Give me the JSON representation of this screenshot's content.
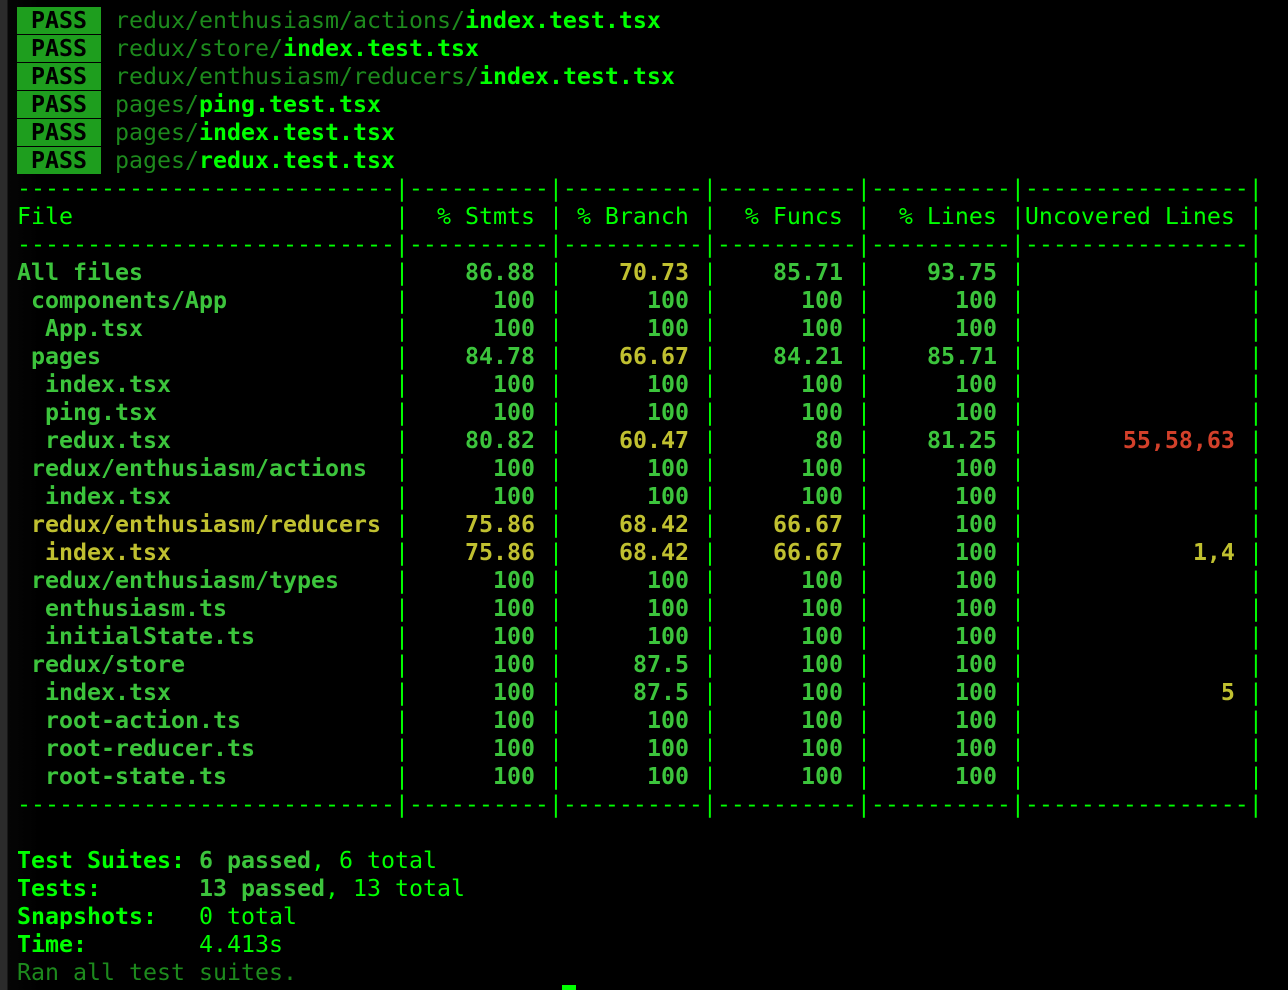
{
  "colors": {
    "high": "#3cc43c",
    "medium": "#c0c030",
    "low": "#d3402a",
    "accent": "#00ff00",
    "pass_badge": "#1e9e1e"
  },
  "test_results": [
    {
      "status": "PASS",
      "dir": "redux/enthusiasm/actions/",
      "file": "index.test.tsx"
    },
    {
      "status": "PASS",
      "dir": "redux/store/",
      "file": "index.test.tsx"
    },
    {
      "status": "PASS",
      "dir": "redux/enthusiasm/reducers/",
      "file": "index.test.tsx"
    },
    {
      "status": "PASS",
      "dir": "pages/",
      "file": "ping.test.tsx"
    },
    {
      "status": "PASS",
      "dir": "pages/",
      "file": "index.test.tsx"
    },
    {
      "status": "PASS",
      "dir": "pages/",
      "file": "redux.test.tsx"
    }
  ],
  "coverage": {
    "headers": [
      "File",
      "% Stmts",
      "% Branch",
      "% Funcs",
      "% Lines",
      "Uncovered Lines"
    ],
    "rows": [
      {
        "indent": 0,
        "file": "All files",
        "stmts": "86.88",
        "branch": "70.73",
        "funcs": "85.71",
        "lines": "93.75",
        "uncovered": "",
        "levels": [
          "high",
          "high",
          "medium",
          "high",
          "high",
          ""
        ]
      },
      {
        "indent": 1,
        "file": "components/App",
        "stmts": "100",
        "branch": "100",
        "funcs": "100",
        "lines": "100",
        "uncovered": "",
        "levels": [
          "high",
          "high",
          "high",
          "high",
          "high",
          ""
        ]
      },
      {
        "indent": 2,
        "file": "App.tsx",
        "stmts": "100",
        "branch": "100",
        "funcs": "100",
        "lines": "100",
        "uncovered": "",
        "levels": [
          "high",
          "high",
          "high",
          "high",
          "high",
          ""
        ]
      },
      {
        "indent": 1,
        "file": "pages",
        "stmts": "84.78",
        "branch": "66.67",
        "funcs": "84.21",
        "lines": "85.71",
        "uncovered": "",
        "levels": [
          "high",
          "high",
          "medium",
          "high",
          "high",
          ""
        ]
      },
      {
        "indent": 2,
        "file": "index.tsx",
        "stmts": "100",
        "branch": "100",
        "funcs": "100",
        "lines": "100",
        "uncovered": "",
        "levels": [
          "high",
          "high",
          "high",
          "high",
          "high",
          ""
        ]
      },
      {
        "indent": 2,
        "file": "ping.tsx",
        "stmts": "100",
        "branch": "100",
        "funcs": "100",
        "lines": "100",
        "uncovered": "",
        "levels": [
          "high",
          "high",
          "high",
          "high",
          "high",
          ""
        ]
      },
      {
        "indent": 2,
        "file": "redux.tsx",
        "stmts": "80.82",
        "branch": "60.47",
        "funcs": "80",
        "lines": "81.25",
        "uncovered": "55,58,63",
        "levels": [
          "high",
          "high",
          "medium",
          "high",
          "high",
          "low"
        ]
      },
      {
        "indent": 1,
        "file": "redux/enthusiasm/actions",
        "stmts": "100",
        "branch": "100",
        "funcs": "100",
        "lines": "100",
        "uncovered": "",
        "levels": [
          "high",
          "high",
          "high",
          "high",
          "high",
          ""
        ]
      },
      {
        "indent": 2,
        "file": "index.tsx",
        "stmts": "100",
        "branch": "100",
        "funcs": "100",
        "lines": "100",
        "uncovered": "",
        "levels": [
          "high",
          "high",
          "high",
          "high",
          "high",
          ""
        ]
      },
      {
        "indent": 1,
        "file": "redux/enthusiasm/reducers",
        "stmts": "75.86",
        "branch": "68.42",
        "funcs": "66.67",
        "lines": "100",
        "uncovered": "",
        "levels": [
          "medium",
          "medium",
          "medium",
          "medium",
          "high",
          ""
        ]
      },
      {
        "indent": 2,
        "file": "index.tsx",
        "stmts": "75.86",
        "branch": "68.42",
        "funcs": "66.67",
        "lines": "100",
        "uncovered": "1,4",
        "levels": [
          "medium",
          "medium",
          "medium",
          "medium",
          "high",
          "medium"
        ]
      },
      {
        "indent": 1,
        "file": "redux/enthusiasm/types",
        "stmts": "100",
        "branch": "100",
        "funcs": "100",
        "lines": "100",
        "uncovered": "",
        "levels": [
          "high",
          "high",
          "high",
          "high",
          "high",
          ""
        ]
      },
      {
        "indent": 2,
        "file": "enthusiasm.ts",
        "stmts": "100",
        "branch": "100",
        "funcs": "100",
        "lines": "100",
        "uncovered": "",
        "levels": [
          "high",
          "high",
          "high",
          "high",
          "high",
          ""
        ]
      },
      {
        "indent": 2,
        "file": "initialState.ts",
        "stmts": "100",
        "branch": "100",
        "funcs": "100",
        "lines": "100",
        "uncovered": "",
        "levels": [
          "high",
          "high",
          "high",
          "high",
          "high",
          ""
        ]
      },
      {
        "indent": 1,
        "file": "redux/store",
        "stmts": "100",
        "branch": "87.5",
        "funcs": "100",
        "lines": "100",
        "uncovered": "",
        "levels": [
          "high",
          "high",
          "high",
          "high",
          "high",
          ""
        ]
      },
      {
        "indent": 2,
        "file": "index.tsx",
        "stmts": "100",
        "branch": "87.5",
        "funcs": "100",
        "lines": "100",
        "uncovered": "5",
        "levels": [
          "high",
          "high",
          "high",
          "high",
          "high",
          "medium"
        ]
      },
      {
        "indent": 2,
        "file": "root-action.ts",
        "stmts": "100",
        "branch": "100",
        "funcs": "100",
        "lines": "100",
        "uncovered": "",
        "levels": [
          "high",
          "high",
          "high",
          "high",
          "high",
          ""
        ]
      },
      {
        "indent": 2,
        "file": "root-reducer.ts",
        "stmts": "100",
        "branch": "100",
        "funcs": "100",
        "lines": "100",
        "uncovered": "",
        "levels": [
          "high",
          "high",
          "high",
          "high",
          "high",
          ""
        ]
      },
      {
        "indent": 2,
        "file": "root-state.ts",
        "stmts": "100",
        "branch": "100",
        "funcs": "100",
        "lines": "100",
        "uncovered": "",
        "levels": [
          "high",
          "high",
          "high",
          "high",
          "high",
          ""
        ]
      }
    ]
  },
  "summary": {
    "suites": {
      "label": "Test Suites:",
      "passed": "6 passed",
      "rest": ", 6 total"
    },
    "tests": {
      "label": "Tests:",
      "passed": "13 passed",
      "rest": ", 13 total"
    },
    "snapshots": {
      "label": "Snapshots:",
      "value": "0 total"
    },
    "time": {
      "label": "Time:",
      "value": "4.413s"
    },
    "footer": "Ran all test suites."
  }
}
